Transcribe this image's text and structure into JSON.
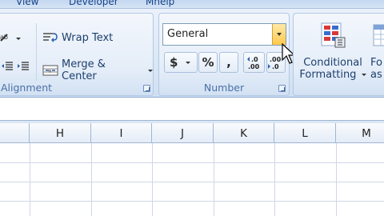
{
  "tabs": [
    "View",
    "Developer",
    "Mhelp"
  ],
  "alignment_group": {
    "label": "Alignment",
    "wrap_text_label": "Wrap Text",
    "merge_center_label": "Merge & Center"
  },
  "number_group": {
    "label": "Number",
    "format_value": "General",
    "currency_label": "$",
    "percent_label": "%",
    "comma_label": ",",
    "increase_decimal_label": "←.0\n.00",
    "decrease_decimal_label": ".00\n→.0"
  },
  "styles_group": {
    "conditional_formatting_line1": "Conditional",
    "conditional_formatting_line2": "Formatting",
    "format_as_table_line1": "Fo",
    "format_as_table_line2": "as T"
  },
  "columns": [
    "H",
    "I",
    "J",
    "K",
    "L",
    "M"
  ],
  "colors": {
    "ribbon_accent": "#15428b",
    "group_label": "#4a70a8",
    "dropdown_highlight": "#ffc94d"
  }
}
